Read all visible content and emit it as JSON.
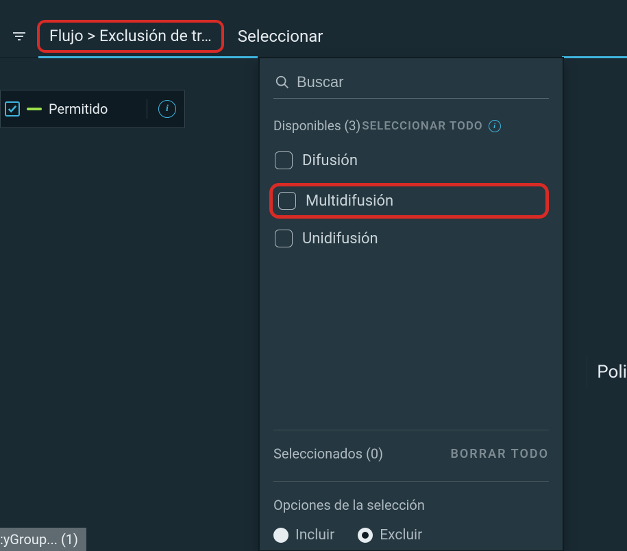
{
  "topbar": {
    "breadcrumb": "Flujo > Exclusión de tr…",
    "panel_title": "Seleccionar"
  },
  "permitido": {
    "label": "Permitido"
  },
  "side": {
    "poli": "Poli"
  },
  "bottom": {
    "group_chip": ":yGroup... (1)"
  },
  "panel": {
    "search_placeholder": "Buscar",
    "available_label": "Disponibles (3)",
    "select_all": "SELECCIONAR TODO",
    "options": [
      {
        "label": "Difusión",
        "checked": false,
        "highlight": false
      },
      {
        "label": "Multidifusión",
        "checked": false,
        "highlight": true
      },
      {
        "label": "Unidifusión",
        "checked": false,
        "highlight": false
      }
    ],
    "selected_label": "Seleccionados (0)",
    "clear_all": "BORRAR TODO",
    "selection_options_title": "Opciones de la selección",
    "radios": {
      "include": "Incluir",
      "exclude": "Excluir",
      "selected": "exclude"
    }
  }
}
